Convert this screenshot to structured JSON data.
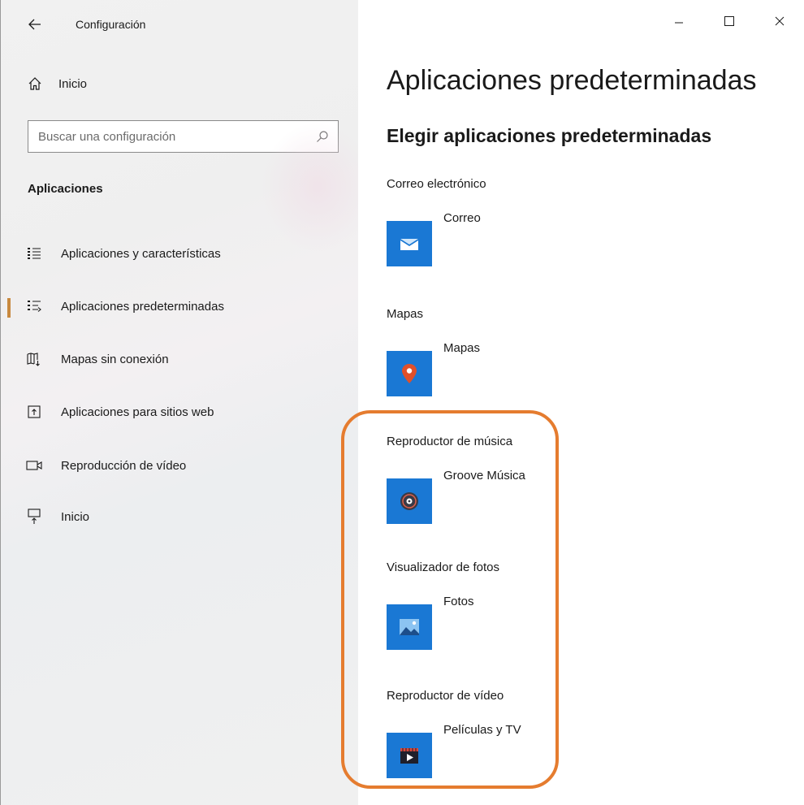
{
  "window": {
    "title": "Configuración",
    "controls": {
      "minimize": "—",
      "maximize": "☐",
      "close": "✕"
    }
  },
  "sidebar": {
    "home_label": "Inicio",
    "search": {
      "placeholder": "Buscar una configuración",
      "value": ""
    },
    "section_title": "Aplicaciones",
    "items": [
      {
        "label": "Aplicaciones y características",
        "icon": "apps-list-icon"
      },
      {
        "label": "Aplicaciones predeterminadas",
        "icon": "default-apps-icon",
        "selected": true
      },
      {
        "label": "Mapas sin conexión",
        "icon": "offline-maps-icon"
      },
      {
        "label": "Aplicaciones para sitios web",
        "icon": "website-apps-icon"
      },
      {
        "label": "Reproducción de vídeo",
        "icon": "video-playback-icon"
      },
      {
        "label": "Inicio",
        "icon": "startup-icon"
      }
    ]
  },
  "main": {
    "page_title": "Aplicaciones predeterminadas",
    "subtitle": "Elegir aplicaciones predeterminadas",
    "categories": [
      {
        "label": "Correo electrónico",
        "app": "Correo",
        "icon": "mail-icon"
      },
      {
        "label": "Mapas",
        "app": "Mapas",
        "icon": "maps-pin-icon"
      },
      {
        "label": "Reproductor de música",
        "app": "Groove Música",
        "icon": "groove-music-icon"
      },
      {
        "label": "Visualizador de fotos",
        "app": "Fotos",
        "icon": "photos-icon"
      },
      {
        "label": "Reproductor de vídeo",
        "app": "Películas y TV",
        "icon": "movies-tv-icon"
      }
    ]
  },
  "colors": {
    "accent_tile": "#1a78d4",
    "selection_bar": "#c8893f",
    "highlight_annotation": "#e57c2f"
  }
}
